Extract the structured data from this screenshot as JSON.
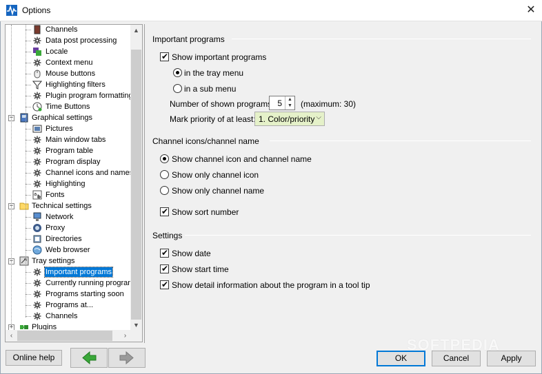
{
  "window": {
    "title": "Options",
    "close_glyph": "✕"
  },
  "tree": {
    "items": [
      {
        "label": "Channels",
        "icon": "channels-icon",
        "level": 2
      },
      {
        "label": "Data post processing",
        "icon": "gear-icon",
        "level": 2
      },
      {
        "label": "Locale",
        "icon": "locale-icon",
        "level": 2
      },
      {
        "label": "Context menu",
        "icon": "gear-icon",
        "level": 2
      },
      {
        "label": "Mouse buttons",
        "icon": "mouse-icon",
        "level": 2
      },
      {
        "label": "Highlighting filters",
        "icon": "filter-icon",
        "level": 2
      },
      {
        "label": "Plugin program formatting",
        "icon": "gear-icon",
        "level": 2
      },
      {
        "label": "Time Buttons",
        "icon": "clock-icon",
        "level": 2
      },
      {
        "label": "Graphical settings",
        "icon": "graphics-icon",
        "level": 1,
        "expander": "−"
      },
      {
        "label": "Pictures",
        "icon": "pictures-icon",
        "level": 2
      },
      {
        "label": "Main window tabs",
        "icon": "gear-icon",
        "level": 2
      },
      {
        "label": "Program table",
        "icon": "gear-icon",
        "level": 2
      },
      {
        "label": "Program display",
        "icon": "gear-icon",
        "level": 2
      },
      {
        "label": "Channel icons and names",
        "icon": "gear-icon",
        "level": 2
      },
      {
        "label": "Highlighting",
        "icon": "gear-icon",
        "level": 2
      },
      {
        "label": "Fonts",
        "icon": "fonts-icon",
        "level": 2
      },
      {
        "label": "Technical settings",
        "icon": "folder-icon",
        "level": 1,
        "expander": "−"
      },
      {
        "label": "Network",
        "icon": "network-icon",
        "level": 2
      },
      {
        "label": "Proxy",
        "icon": "proxy-icon",
        "level": 2
      },
      {
        "label": "Directories",
        "icon": "directories-icon",
        "level": 2
      },
      {
        "label": "Web browser",
        "icon": "web-browser-icon",
        "level": 2
      },
      {
        "label": "Tray settings",
        "icon": "tray-icon",
        "level": 1,
        "expander": "−"
      },
      {
        "label": "Important programs",
        "icon": "gear-icon",
        "level": 2,
        "selected": true
      },
      {
        "label": "Currently running program",
        "icon": "gear-icon",
        "level": 2
      },
      {
        "label": "Programs starting soon",
        "icon": "gear-icon",
        "level": 2
      },
      {
        "label": "Programs at...",
        "icon": "gear-icon",
        "level": 2
      },
      {
        "label": "Channels",
        "icon": "gear-icon",
        "level": 2
      },
      {
        "label": "Plugins",
        "icon": "plugins-icon",
        "level": 1,
        "expander": "+"
      }
    ]
  },
  "important": {
    "title": "Important programs",
    "show_label": "Show important programs",
    "show_checked": true,
    "tray_label": "in the tray menu",
    "tray_selected": true,
    "sub_label": "in a sub menu",
    "sub_selected": false,
    "count_label": "Number of shown programs:",
    "count_value": "5",
    "count_max": "(maximum: 30)",
    "priority_label": "Mark priority of at least:",
    "priority_value": "1. Color/priority"
  },
  "channel": {
    "title": "Channel icons/channel name",
    "opt_both": "Show channel icon and channel name",
    "opt_icon": "Show only channel icon",
    "opt_name": "Show only channel name",
    "selected": "both",
    "sort_label": "Show sort number",
    "sort_checked": true
  },
  "settings": {
    "title": "Settings",
    "date_label": "Show date",
    "start_label": "Show start time",
    "detail_label": "Show detail information about the program in a tool tip"
  },
  "buttons": {
    "online_help": "Online help",
    "ok": "OK",
    "cancel": "Cancel",
    "apply": "Apply"
  },
  "watermark": "SOFTPEDIA",
  "colors": {
    "selection": "#0078d7",
    "back_arrow": "#3aa839",
    "forward_arrow": "#9a9a9a",
    "combo_bg": "#e5f1c9"
  }
}
